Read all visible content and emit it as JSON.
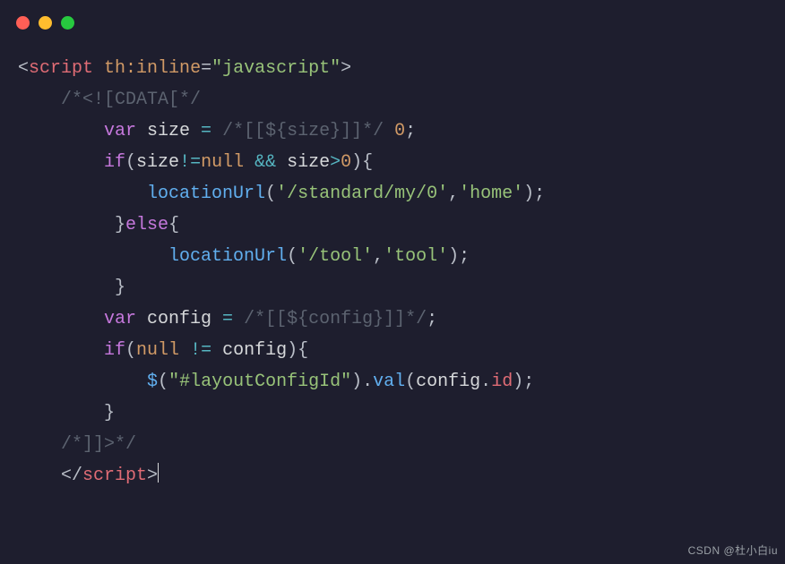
{
  "titlebar": {
    "buttons": [
      "close",
      "minimize",
      "zoom"
    ]
  },
  "code": {
    "lines": [
      {
        "indent": 0,
        "tokens": [
          {
            "cls": "c-punc",
            "t": "<"
          },
          {
            "cls": "c-tag",
            "t": "script"
          },
          {
            "cls": "c-ident",
            "t": " "
          },
          {
            "cls": "c-attr",
            "t": "th:inline"
          },
          {
            "cls": "c-punc",
            "t": "="
          },
          {
            "cls": "c-str",
            "t": "\"javascript\""
          },
          {
            "cls": "c-punc",
            "t": ">"
          }
        ]
      },
      {
        "indent": 4,
        "tokens": [
          {
            "cls": "c-comment",
            "t": "/*<![CDATA[*/"
          }
        ]
      },
      {
        "indent": 8,
        "tokens": [
          {
            "cls": "c-kw",
            "t": "var"
          },
          {
            "cls": "c-ident",
            "t": " size "
          },
          {
            "cls": "c-op",
            "t": "="
          },
          {
            "cls": "c-ident",
            "t": " "
          },
          {
            "cls": "c-comment",
            "t": "/*[[${size}]]*/"
          },
          {
            "cls": "c-ident",
            "t": " "
          },
          {
            "cls": "c-num",
            "t": "0"
          },
          {
            "cls": "c-punc",
            "t": ";"
          }
        ]
      },
      {
        "indent": 8,
        "tokens": [
          {
            "cls": "c-kw",
            "t": "if"
          },
          {
            "cls": "c-punc",
            "t": "("
          },
          {
            "cls": "c-ident",
            "t": "size"
          },
          {
            "cls": "c-op",
            "t": "!="
          },
          {
            "cls": "c-null",
            "t": "null"
          },
          {
            "cls": "c-ident",
            "t": " "
          },
          {
            "cls": "c-op",
            "t": "&&"
          },
          {
            "cls": "c-ident",
            "t": " size"
          },
          {
            "cls": "c-op",
            "t": ">"
          },
          {
            "cls": "c-num",
            "t": "0"
          },
          {
            "cls": "c-punc",
            "t": "){"
          }
        ]
      },
      {
        "indent": 12,
        "tokens": [
          {
            "cls": "c-fn",
            "t": "locationUrl"
          },
          {
            "cls": "c-punc",
            "t": "("
          },
          {
            "cls": "c-str",
            "t": "'/standard/my/0'"
          },
          {
            "cls": "c-punc",
            "t": ","
          },
          {
            "cls": "c-str",
            "t": "'home'"
          },
          {
            "cls": "c-punc",
            "t": ");"
          }
        ]
      },
      {
        "indent": 9,
        "tokens": [
          {
            "cls": "c-punc",
            "t": "}"
          },
          {
            "cls": "c-kw",
            "t": "else"
          },
          {
            "cls": "c-punc",
            "t": "{"
          }
        ]
      },
      {
        "indent": 14,
        "tokens": [
          {
            "cls": "c-fn",
            "t": "locationUrl"
          },
          {
            "cls": "c-punc",
            "t": "("
          },
          {
            "cls": "c-str",
            "t": "'/tool'"
          },
          {
            "cls": "c-punc",
            "t": ","
          },
          {
            "cls": "c-str",
            "t": "'tool'"
          },
          {
            "cls": "c-punc",
            "t": ");"
          }
        ]
      },
      {
        "indent": 9,
        "tokens": [
          {
            "cls": "c-punc",
            "t": "}"
          }
        ]
      },
      {
        "indent": 8,
        "tokens": [
          {
            "cls": "c-kw",
            "t": "var"
          },
          {
            "cls": "c-ident",
            "t": " config "
          },
          {
            "cls": "c-op",
            "t": "="
          },
          {
            "cls": "c-ident",
            "t": " "
          },
          {
            "cls": "c-comment",
            "t": "/*[[${config}]]*/"
          },
          {
            "cls": "c-punc",
            "t": ";"
          }
        ]
      },
      {
        "indent": 8,
        "tokens": [
          {
            "cls": "c-kw",
            "t": "if"
          },
          {
            "cls": "c-punc",
            "t": "("
          },
          {
            "cls": "c-null",
            "t": "null"
          },
          {
            "cls": "c-ident",
            "t": " "
          },
          {
            "cls": "c-op",
            "t": "!="
          },
          {
            "cls": "c-ident",
            "t": " config"
          },
          {
            "cls": "c-punc",
            "t": "){"
          }
        ]
      },
      {
        "indent": 12,
        "tokens": [
          {
            "cls": "c-fn",
            "t": "$"
          },
          {
            "cls": "c-punc",
            "t": "("
          },
          {
            "cls": "c-str",
            "t": "\"#layoutConfigId\""
          },
          {
            "cls": "c-punc",
            "t": ")."
          },
          {
            "cls": "c-fn",
            "t": "val"
          },
          {
            "cls": "c-punc",
            "t": "("
          },
          {
            "cls": "c-ident",
            "t": "config"
          },
          {
            "cls": "c-punc",
            "t": "."
          },
          {
            "cls": "c-prop",
            "t": "id"
          },
          {
            "cls": "c-punc",
            "t": ");"
          }
        ]
      },
      {
        "indent": 8,
        "tokens": [
          {
            "cls": "c-punc",
            "t": "}"
          }
        ]
      },
      {
        "indent": 4,
        "tokens": [
          {
            "cls": "c-comment",
            "t": "/*]]>*/"
          }
        ]
      },
      {
        "indent": 4,
        "tokens": [
          {
            "cls": "c-punc",
            "t": "</"
          },
          {
            "cls": "c-tag",
            "t": "script"
          },
          {
            "cls": "c-punc",
            "t": ">"
          }
        ],
        "cursor": true
      }
    ]
  },
  "watermark": "CSDN @杜小白iu"
}
